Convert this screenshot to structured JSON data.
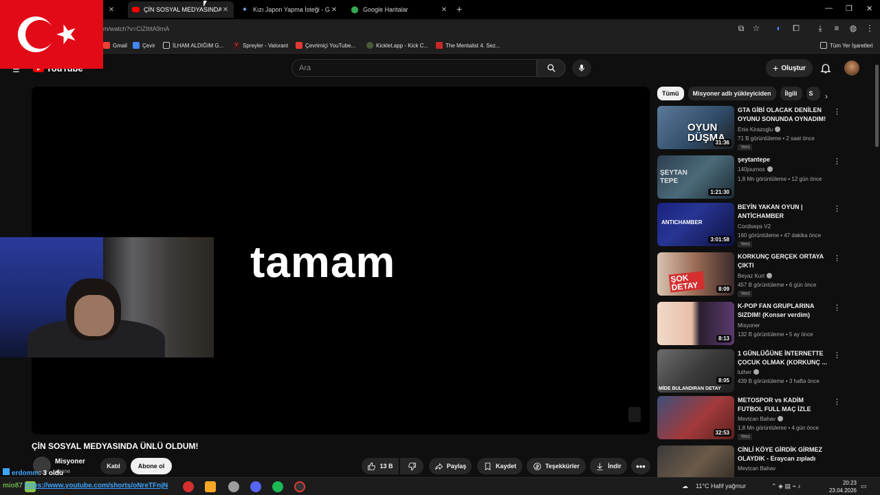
{
  "browser": {
    "tabs": [
      {
        "title": "ÇİN SOSYAL MEDYASINDA ÜNLÜ...",
        "active": true
      },
      {
        "title": "Kızı Japon Yapma İsteği - Goog",
        "active": false
      },
      {
        "title": "Google Haritalar",
        "active": false
      }
    ],
    "url": "m/watch?v=CiZItitA9mA",
    "bookmarks": [
      "Gmail",
      "Çevir",
      "İLHAM ALDIĞIM G...",
      "Spreyler - Valorant",
      "Çevrimiçi YouTube...",
      "Kicklet.app - Kick C...",
      "The Mentalist 4. Sez..."
    ],
    "bookmarks_folder": "Tüm Yer İşaretleri"
  },
  "youtube": {
    "logo": "YouTube",
    "search_placeholder": "Ara",
    "create_label": "Oluştur",
    "player_text": "tamam",
    "video_title": "ÇİN SOSYAL MEDYASINDA ÜNLÜ OLDUM!",
    "channel": {
      "name": "Misyoner",
      "subs": "abone"
    },
    "join_label": "Katıl",
    "subscribe_label": "Abone ol",
    "actions": {
      "likes": "13 B",
      "share": "Paylaş",
      "save": "Kaydet",
      "thanks": "Teşekkürler",
      "download": "İndir"
    },
    "chips": [
      "Tümü",
      "Misyoner adlı yükleyiciden",
      "İlgili",
      "S"
    ],
    "recommendations": [
      {
        "title": "GTA GİBİ OLACAK DENİLEN OYUNU SONUNDA OYNADIM! ...",
        "channel": "Enis Kirazoglu",
        "verified": true,
        "meta": "71 B görüntüleme • 2 saat önce",
        "badge": "Yeni",
        "duration": "31:36",
        "thumb_text": "OYUN DÜŞMA"
      },
      {
        "title": "şeytantepe",
        "channel": "140journos",
        "verified": true,
        "meta": "1,8 Mn görüntüleme • 12 gün önce",
        "badge": "",
        "duration": "1:21:30",
        "thumb_text": "ŞEYTAN TEPE"
      },
      {
        "title": "BEYİN YAKAN OYUN | ANTİCHAMBER",
        "channel": "Cordiseps V2",
        "verified": false,
        "meta": "160 görüntüleme • 47 dakika önce",
        "badge": "Yeni",
        "duration": "3:01:58",
        "thumb_text": "ANTICHAMBER"
      },
      {
        "title": "KORKUNÇ GERÇEK ORTAYA ÇIKTI",
        "channel": "Beyaz Kurt",
        "verified": true,
        "meta": "457 B görüntüleme • 6 gün önce",
        "badge": "Yeni",
        "duration": "8:09",
        "thumb_text": "ŞOK DETAY"
      },
      {
        "title": "K-POP FAN GRUPLARINA SIZDIM! (Konser verdim)",
        "channel": "Misyoner",
        "verified": false,
        "meta": "132 B görüntüleme • 5 ay önce",
        "badge": "",
        "duration": "8:13",
        "thumb_text": ""
      },
      {
        "title": "1 GÜNLÜĞÜNE İNTERNETTE ÇOCUK OLMAK (KORKUNÇ ...",
        "channel": "luther",
        "verified": true,
        "meta": "439 B görüntüleme • 3 hafta önce",
        "badge": "",
        "duration": "8:05",
        "thumb_text": "MİDE BULANDIRAN DETAY"
      },
      {
        "title": "METOSPOR vs KADİM FUTBOL FULL MAÇ İZLE",
        "channel": "Mevtcan Bahav",
        "verified": true,
        "meta": "1,8 Mn görüntüleme • 4 gün önce",
        "badge": "Yeni",
        "duration": "32:53",
        "thumb_text": ""
      },
      {
        "title": "CİNLİ KÖYE GİRDİK GİRMEZ OLAYDIK - Eraycan zıpladı",
        "channel": "Mevtcan Bahav",
        "verified": false,
        "meta": "",
        "badge": "",
        "duration": "",
        "thumb_text": ""
      }
    ]
  },
  "overlay": {
    "chat_line1_user": "erdomm",
    "chat_line1_text": ": 3 oldu",
    "chat_line2_user": "mio87",
    "chat_line2_text": "https://www.youtube.com/shorts/oNreTFnjN"
  },
  "taskbar": {
    "weather": "11°C  Hafif yağmur",
    "time": "20:23",
    "date": "23.04.2026"
  }
}
